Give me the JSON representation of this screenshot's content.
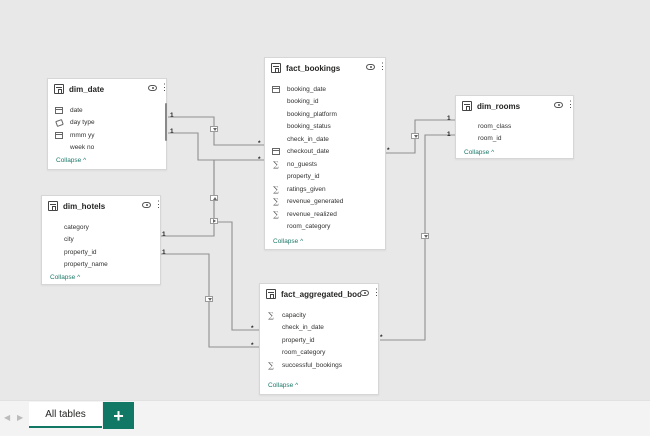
{
  "tables": {
    "dim_date": {
      "title": "dim_date",
      "fields": [
        {
          "name": "date",
          "icon": "calendar-icon"
        },
        {
          "name": "day type",
          "icon": "tag-icon"
        },
        {
          "name": "mmm yy",
          "icon": "calendar-icon"
        },
        {
          "name": "week no",
          "icon": ""
        }
      ],
      "collapse": "Collapse ^"
    },
    "fact_bookings": {
      "title": "fact_bookings",
      "fields": [
        {
          "name": "booking_date",
          "icon": "calendar-icon"
        },
        {
          "name": "booking_id",
          "icon": ""
        },
        {
          "name": "booking_platform",
          "icon": ""
        },
        {
          "name": "booking_status",
          "icon": ""
        },
        {
          "name": "check_in_date",
          "icon": ""
        },
        {
          "name": "checkout_date",
          "icon": "calendar-icon"
        },
        {
          "name": "no_guests",
          "icon": "sigma-icon"
        },
        {
          "name": "property_id",
          "icon": ""
        },
        {
          "name": "ratings_given",
          "icon": "sigma-icon"
        },
        {
          "name": "revenue_generated",
          "icon": "sigma-icon"
        },
        {
          "name": "revenue_realized",
          "icon": "sigma-icon"
        },
        {
          "name": "room_category",
          "icon": ""
        }
      ],
      "collapse": "Collapse ^"
    },
    "dim_rooms": {
      "title": "dim_rooms",
      "fields": [
        {
          "name": "room_class",
          "icon": ""
        },
        {
          "name": "room_id",
          "icon": ""
        }
      ],
      "collapse": "Collapse ^"
    },
    "dim_hotels": {
      "title": "dim_hotels",
      "fields": [
        {
          "name": "category",
          "icon": ""
        },
        {
          "name": "city",
          "icon": ""
        },
        {
          "name": "property_id",
          "icon": ""
        },
        {
          "name": "property_name",
          "icon": ""
        }
      ],
      "collapse": "Collapse ^"
    },
    "fact_aggregated_bookings": {
      "title": "fact_aggregated_boo...",
      "fields": [
        {
          "name": "capacity",
          "icon": "sigma-icon"
        },
        {
          "name": "check_in_date",
          "icon": ""
        },
        {
          "name": "property_id",
          "icon": ""
        },
        {
          "name": "room_category",
          "icon": ""
        },
        {
          "name": "successful_bookings",
          "icon": "sigma-icon"
        }
      ],
      "collapse": "Collapse ^"
    }
  },
  "relationships": {
    "one": "1",
    "many": "*"
  },
  "bottom_bar": {
    "prev_arrow": "◀",
    "next_arrow": "▶",
    "tab_label": "All tables",
    "add_label": "+",
    "accent": "#117865"
  }
}
